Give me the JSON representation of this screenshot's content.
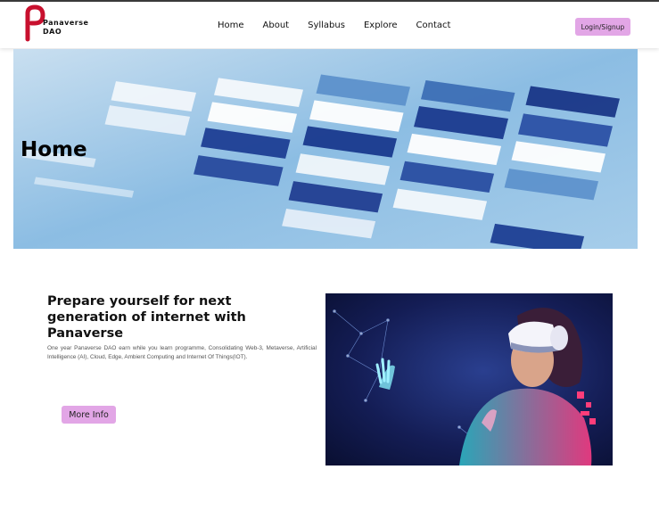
{
  "brand": {
    "name_line1": "Panaverse",
    "name_line2": "DAO",
    "accent": "#c8102e"
  },
  "nav": {
    "items": [
      {
        "label": "Home"
      },
      {
        "label": "About"
      },
      {
        "label": "Syllabus"
      },
      {
        "label": "Explore"
      },
      {
        "label": "Contact"
      }
    ],
    "login_label": "Login/Signup"
  },
  "hero": {
    "title": "Home"
  },
  "intro": {
    "heading": "Prepare yourself for next generation of internet with Panaverse",
    "description": "One year Panaverse DAO earn while you learn programme, Consolidating Web-3, Metaverse, Artificial Intelligence (AI), Cloud, Edge, Ambient Computing and Internet Of Things(IOT).",
    "button_label": "More Info"
  },
  "colors": {
    "button_bg": "#e2a6e6",
    "text": "#111111"
  }
}
